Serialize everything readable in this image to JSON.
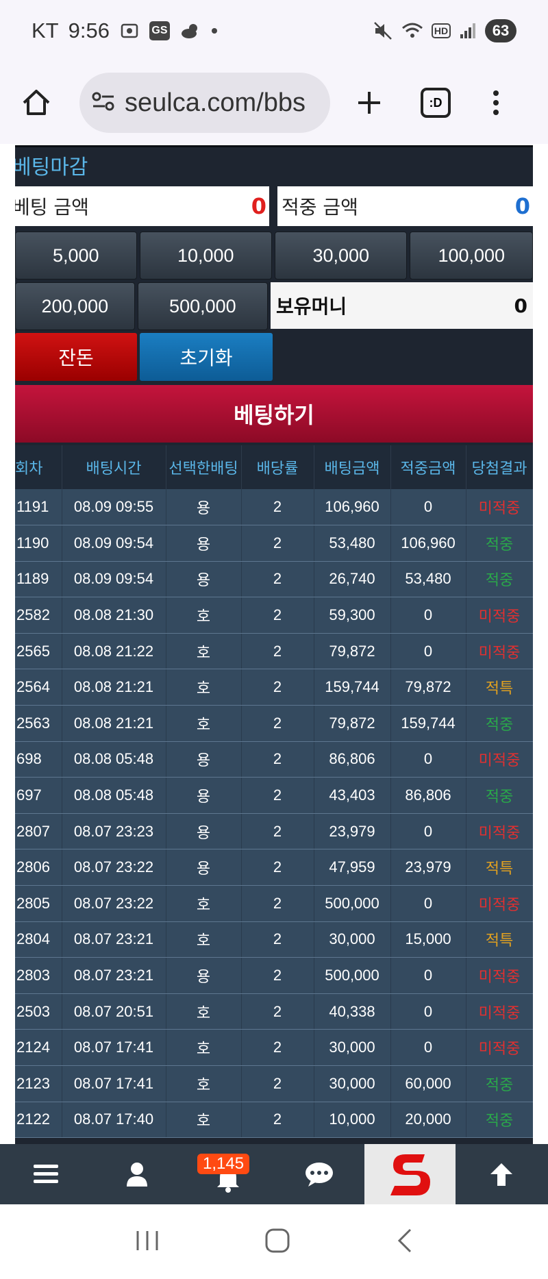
{
  "status_bar": {
    "carrier": "KT",
    "time": "9:56",
    "gs_badge": "GS",
    "battery": "63"
  },
  "browser": {
    "url": "seulca.com/bbs",
    "tabs_label": ":D"
  },
  "betting_panel": {
    "deadline_label": "베팅마감",
    "bet_amount_label": "베팅 금액",
    "bet_amount_value": "0",
    "win_amount_label": "적중 금액",
    "win_amount_value": "0",
    "chips_row1": [
      "5,000",
      "10,000",
      "30,000",
      "100,000"
    ],
    "chips_row2": [
      "200,000",
      "500,000"
    ],
    "holding_money_label": "보유머니",
    "holding_money_value": "0",
    "balance_button": "잔돈",
    "reset_button": "초기화",
    "bet_button": "베팅하기"
  },
  "history": {
    "headers": [
      "회차",
      "배팅시간",
      "선택한배팅",
      "배당률",
      "배팅금액",
      "적중금액",
      "당첨결과"
    ],
    "rows": [
      [
        "1191",
        "08.09 09:55",
        "용",
        "2",
        "106,960",
        "0",
        "미적중"
      ],
      [
        "1190",
        "08.09 09:54",
        "용",
        "2",
        "53,480",
        "106,960",
        "적중"
      ],
      [
        "1189",
        "08.09 09:54",
        "용",
        "2",
        "26,740",
        "53,480",
        "적중"
      ],
      [
        "2582",
        "08.08 21:30",
        "호",
        "2",
        "59,300",
        "0",
        "미적중"
      ],
      [
        "2565",
        "08.08 21:22",
        "호",
        "2",
        "79,872",
        "0",
        "미적중"
      ],
      [
        "2564",
        "08.08 21:21",
        "호",
        "2",
        "159,744",
        "79,872",
        "적특"
      ],
      [
        "2563",
        "08.08 21:21",
        "호",
        "2",
        "79,872",
        "159,744",
        "적중"
      ],
      [
        "698",
        "08.08 05:48",
        "용",
        "2",
        "86,806",
        "0",
        "미적중"
      ],
      [
        "697",
        "08.08 05:48",
        "용",
        "2",
        "43,403",
        "86,806",
        "적중"
      ],
      [
        "2807",
        "08.07 23:23",
        "용",
        "2",
        "23,979",
        "0",
        "미적중"
      ],
      [
        "2806",
        "08.07 23:22",
        "용",
        "2",
        "47,959",
        "23,979",
        "적특"
      ],
      [
        "2805",
        "08.07 23:22",
        "호",
        "2",
        "500,000",
        "0",
        "미적중"
      ],
      [
        "2804",
        "08.07 23:21",
        "호",
        "2",
        "30,000",
        "15,000",
        "적특"
      ],
      [
        "2803",
        "08.07 23:21",
        "용",
        "2",
        "500,000",
        "0",
        "미적중"
      ],
      [
        "2503",
        "08.07 20:51",
        "호",
        "2",
        "40,338",
        "0",
        "미적중"
      ],
      [
        "2124",
        "08.07 17:41",
        "호",
        "2",
        "30,000",
        "0",
        "미적중"
      ],
      [
        "2123",
        "08.07 17:41",
        "호",
        "2",
        "30,000",
        "60,000",
        "적중"
      ],
      [
        "2122",
        "08.07 17:40",
        "호",
        "2",
        "10,000",
        "20,000",
        "적중"
      ]
    ]
  },
  "bottom_nav": {
    "notification_count": "1,145",
    "items": [
      "menu-icon",
      "user-icon",
      "bell-icon",
      "chat-icon",
      "site-logo",
      "arrow-up-icon"
    ]
  },
  "colors": {
    "panel_bg": "#1e2530",
    "row_bg": "#344a5f",
    "header_text": "#5ab6e8",
    "lose": "#e03030",
    "win": "#2aa84a",
    "special": "#e0a020",
    "bet_button": "#b0102e"
  }
}
